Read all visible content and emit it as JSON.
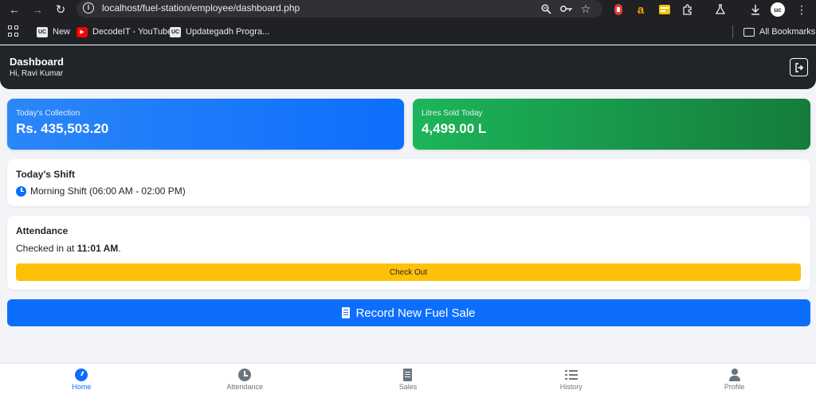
{
  "browser": {
    "url": "localhost/fuel-station/employee/dashboard.php",
    "bookmarks": [
      {
        "label": "New",
        "favicon": "UC"
      },
      {
        "label": "DecodeIT - YouTube",
        "favicon": "youtube"
      },
      {
        "label": "Updategadh Progra...",
        "favicon": "UC"
      }
    ],
    "all_bookmarks_label": "All Bookmarks",
    "profile_initials": "uc",
    "extension_letter": "a"
  },
  "header": {
    "title": "Dashboard",
    "greeting": "Hi, Ravi Kumar"
  },
  "stats": {
    "collection": {
      "label": "Today's Collection",
      "value": "Rs. 435,503.20"
    },
    "litres": {
      "label": "Litres Sold Today",
      "value": "4,499.00 L"
    }
  },
  "shift": {
    "title": "Today's Shift",
    "text": "Morning Shift (06:00 AM - 02:00 PM)"
  },
  "attendance": {
    "title": "Attendance",
    "prefix": "Checked in at ",
    "time": "11:01 AM",
    "suffix": ".",
    "button_label": "Check Out"
  },
  "record_sale": {
    "label": "Record New Fuel Sale"
  },
  "bottom_nav": [
    {
      "label": "Home",
      "icon": "home-icon",
      "active": true
    },
    {
      "label": "Attendance",
      "icon": "clock-icon",
      "active": false
    },
    {
      "label": "Sales",
      "icon": "receipt-icon",
      "active": false
    },
    {
      "label": "History",
      "icon": "list-icon",
      "active": false
    },
    {
      "label": "Profile",
      "icon": "person-icon",
      "active": false
    }
  ],
  "colors": {
    "primary": "#0d6efd",
    "success": "#198754",
    "warning": "#ffc107",
    "header_bg": "#212529"
  }
}
